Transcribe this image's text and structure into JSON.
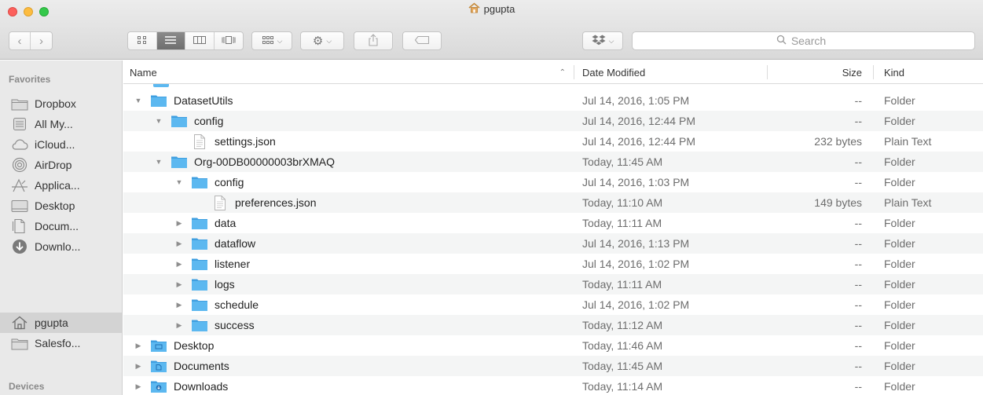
{
  "window": {
    "title": "pgupta"
  },
  "toolbar": {
    "back_icon": "chevron-left",
    "forward_icon": "chevron-right",
    "view_modes": [
      "icon-view",
      "list-view",
      "column-view",
      "cover-flow-view"
    ],
    "arrange_icon": "arrange-grid",
    "action_icon": "gear",
    "share_icon": "share",
    "tags_icon": "tag",
    "dropbox_icon": "dropbox",
    "search": {
      "placeholder": "Search",
      "value": ""
    }
  },
  "sidebar": {
    "sections": [
      {
        "title": "Favorites",
        "items": [
          {
            "label": "Dropbox",
            "icon": "folder"
          },
          {
            "label": "All My...",
            "icon": "all-files"
          },
          {
            "label": "iCloud...",
            "icon": "cloud"
          },
          {
            "label": "AirDrop",
            "icon": "airdrop"
          },
          {
            "label": "Applica...",
            "icon": "applications"
          },
          {
            "label": "Desktop",
            "icon": "desktop"
          },
          {
            "label": "Docum...",
            "icon": "documents"
          },
          {
            "label": "Downlo...",
            "icon": "downloads"
          },
          {
            "label": "pgupta",
            "icon": "home",
            "selected": true
          },
          {
            "label": "Salesfo...",
            "icon": "folder"
          }
        ]
      },
      {
        "title": "Devices",
        "items": []
      }
    ]
  },
  "list": {
    "columns": {
      "name": "Name",
      "date": "Date Modified",
      "size": "Size",
      "kind": "Kind"
    },
    "rows": [
      {
        "name": "DatasetUtils",
        "level": 0,
        "disclosure": "open",
        "type": "folder",
        "date": "Jul 14, 2016, 1:05 PM",
        "size": "--",
        "kind": "Folder"
      },
      {
        "name": "config",
        "level": 1,
        "disclosure": "open",
        "type": "folder",
        "date": "Jul 14, 2016, 12:44 PM",
        "size": "--",
        "kind": "Folder"
      },
      {
        "name": "settings.json",
        "level": 2,
        "disclosure": "none",
        "type": "file",
        "date": "Jul 14, 2016, 12:44 PM",
        "size": "232 bytes",
        "kind": "Plain Text"
      },
      {
        "name": "Org-00DB00000003brXMAQ",
        "level": 1,
        "disclosure": "open",
        "type": "folder",
        "date": "Today, 11:45 AM",
        "size": "--",
        "kind": "Folder"
      },
      {
        "name": "config",
        "level": 2,
        "disclosure": "open",
        "type": "folder",
        "date": "Jul 14, 2016, 1:03 PM",
        "size": "--",
        "kind": "Folder"
      },
      {
        "name": "preferences.json",
        "level": 3,
        "disclosure": "none",
        "type": "file",
        "date": "Today, 11:10 AM",
        "size": "149 bytes",
        "kind": "Plain Text"
      },
      {
        "name": "data",
        "level": 2,
        "disclosure": "closed",
        "type": "folder",
        "date": "Today, 11:11 AM",
        "size": "--",
        "kind": "Folder"
      },
      {
        "name": "dataflow",
        "level": 2,
        "disclosure": "closed",
        "type": "folder",
        "date": "Jul 14, 2016, 1:13 PM",
        "size": "--",
        "kind": "Folder"
      },
      {
        "name": "listener",
        "level": 2,
        "disclosure": "closed",
        "type": "folder",
        "date": "Jul 14, 2016, 1:02 PM",
        "size": "--",
        "kind": "Folder"
      },
      {
        "name": "logs",
        "level": 2,
        "disclosure": "closed",
        "type": "folder",
        "date": "Today, 11:11 AM",
        "size": "--",
        "kind": "Folder"
      },
      {
        "name": "schedule",
        "level": 2,
        "disclosure": "closed",
        "type": "folder",
        "date": "Jul 14, 2016, 1:02 PM",
        "size": "--",
        "kind": "Folder"
      },
      {
        "name": "success",
        "level": 2,
        "disclosure": "closed",
        "type": "folder",
        "date": "Today, 11:12 AM",
        "size": "--",
        "kind": "Folder"
      },
      {
        "name": "Desktop",
        "level": 0,
        "disclosure": "closed",
        "type": "desktop-folder",
        "date": "Today, 11:46 AM",
        "size": "--",
        "kind": "Folder"
      },
      {
        "name": "Documents",
        "level": 0,
        "disclosure": "closed",
        "type": "documents-folder",
        "date": "Today, 11:45 AM",
        "size": "--",
        "kind": "Folder"
      },
      {
        "name": "Downloads",
        "level": 0,
        "disclosure": "closed",
        "type": "downloads-folder",
        "date": "Today, 11:14 AM",
        "size": "--",
        "kind": "Folder"
      }
    ]
  },
  "colors": {
    "folder": "#5cb8f0",
    "folder_tab": "#3f9fe0",
    "selection": "#d3d3d3",
    "sidebar_bg": "#e9e9e9",
    "row_alt": "#f4f5f5"
  }
}
